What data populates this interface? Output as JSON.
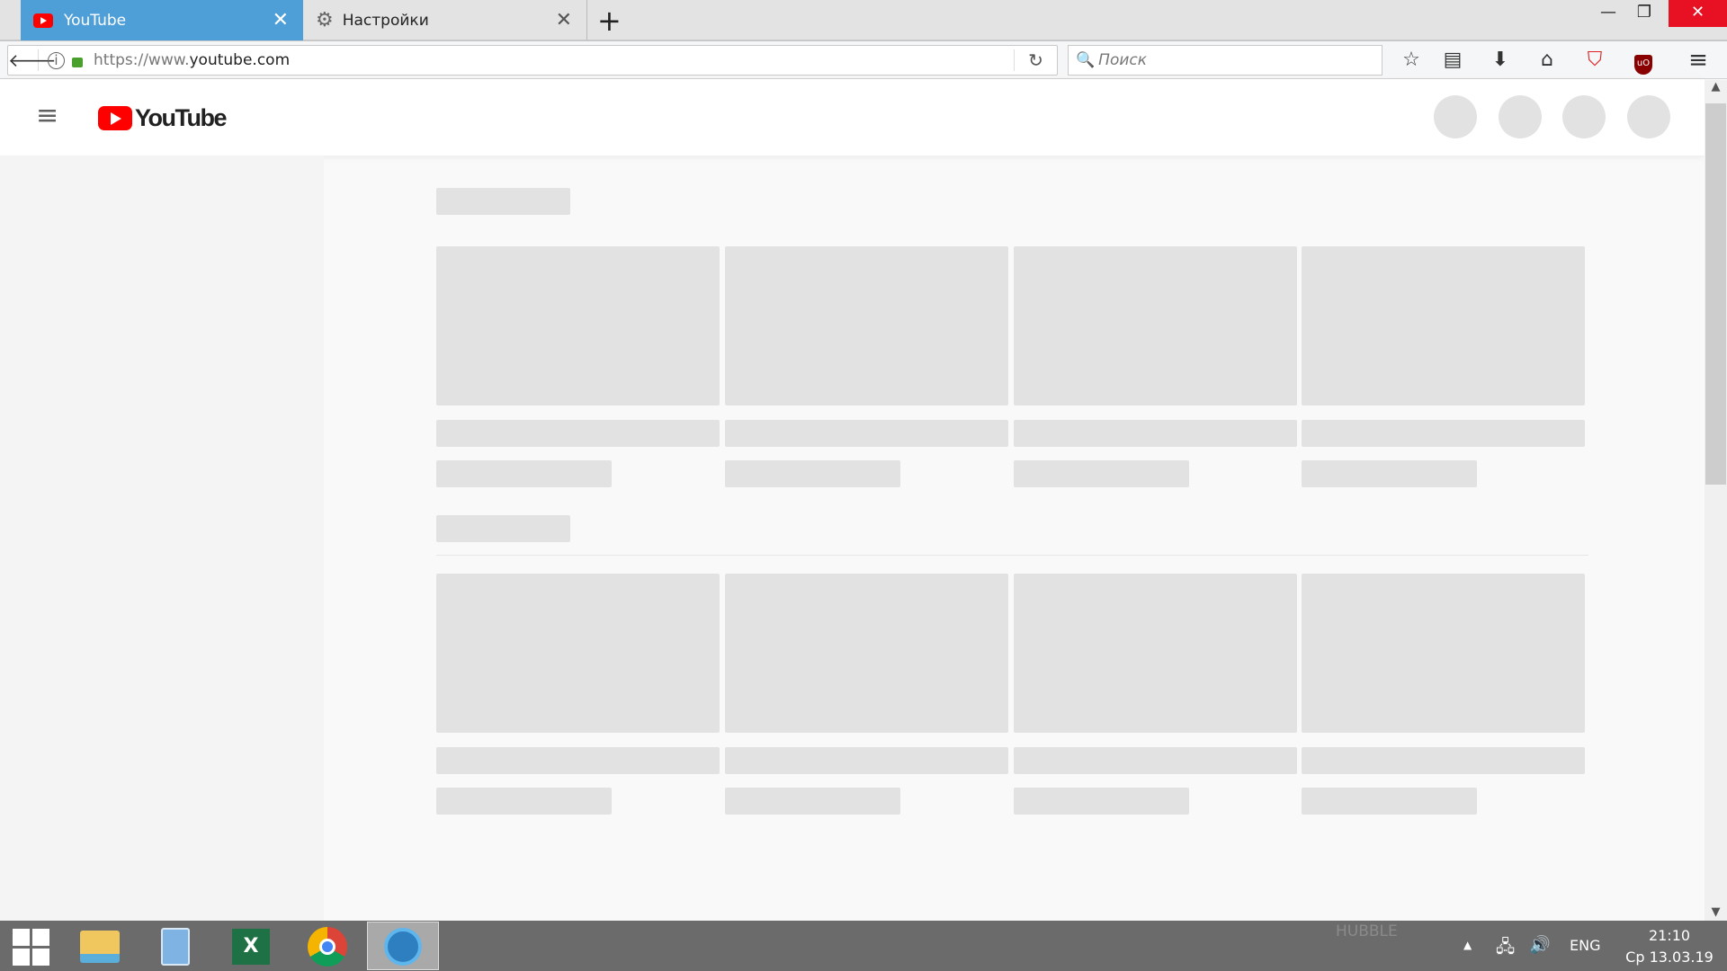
{
  "browser": {
    "tabs": [
      {
        "label": "YouTube",
        "icon": "youtube-icon",
        "active": true
      },
      {
        "label": "Настройки",
        "icon": "gear-icon",
        "active": false
      }
    ],
    "url_prefix": "https://www.",
    "url_domain": "youtube.com",
    "search_placeholder": "Поиск",
    "toolbar_icons": [
      "star-icon",
      "reading-list-icon",
      "download-icon",
      "home-icon",
      "shield-icon",
      "ublock-icon",
      "menu-icon"
    ]
  },
  "youtube": {
    "logo": "YouTube",
    "brand_color": "#ff0000",
    "loading_skeleton": true
  },
  "taskbar": {
    "apps": [
      "windows-start-icon",
      "file-explorer-icon",
      "calculator-icon",
      "excel-icon",
      "chrome-icon",
      "waterfox-icon"
    ],
    "wallpaper_text": "HUBBLE",
    "language": "ENG",
    "time": "21:10",
    "date": "Ср 13.03.19"
  }
}
